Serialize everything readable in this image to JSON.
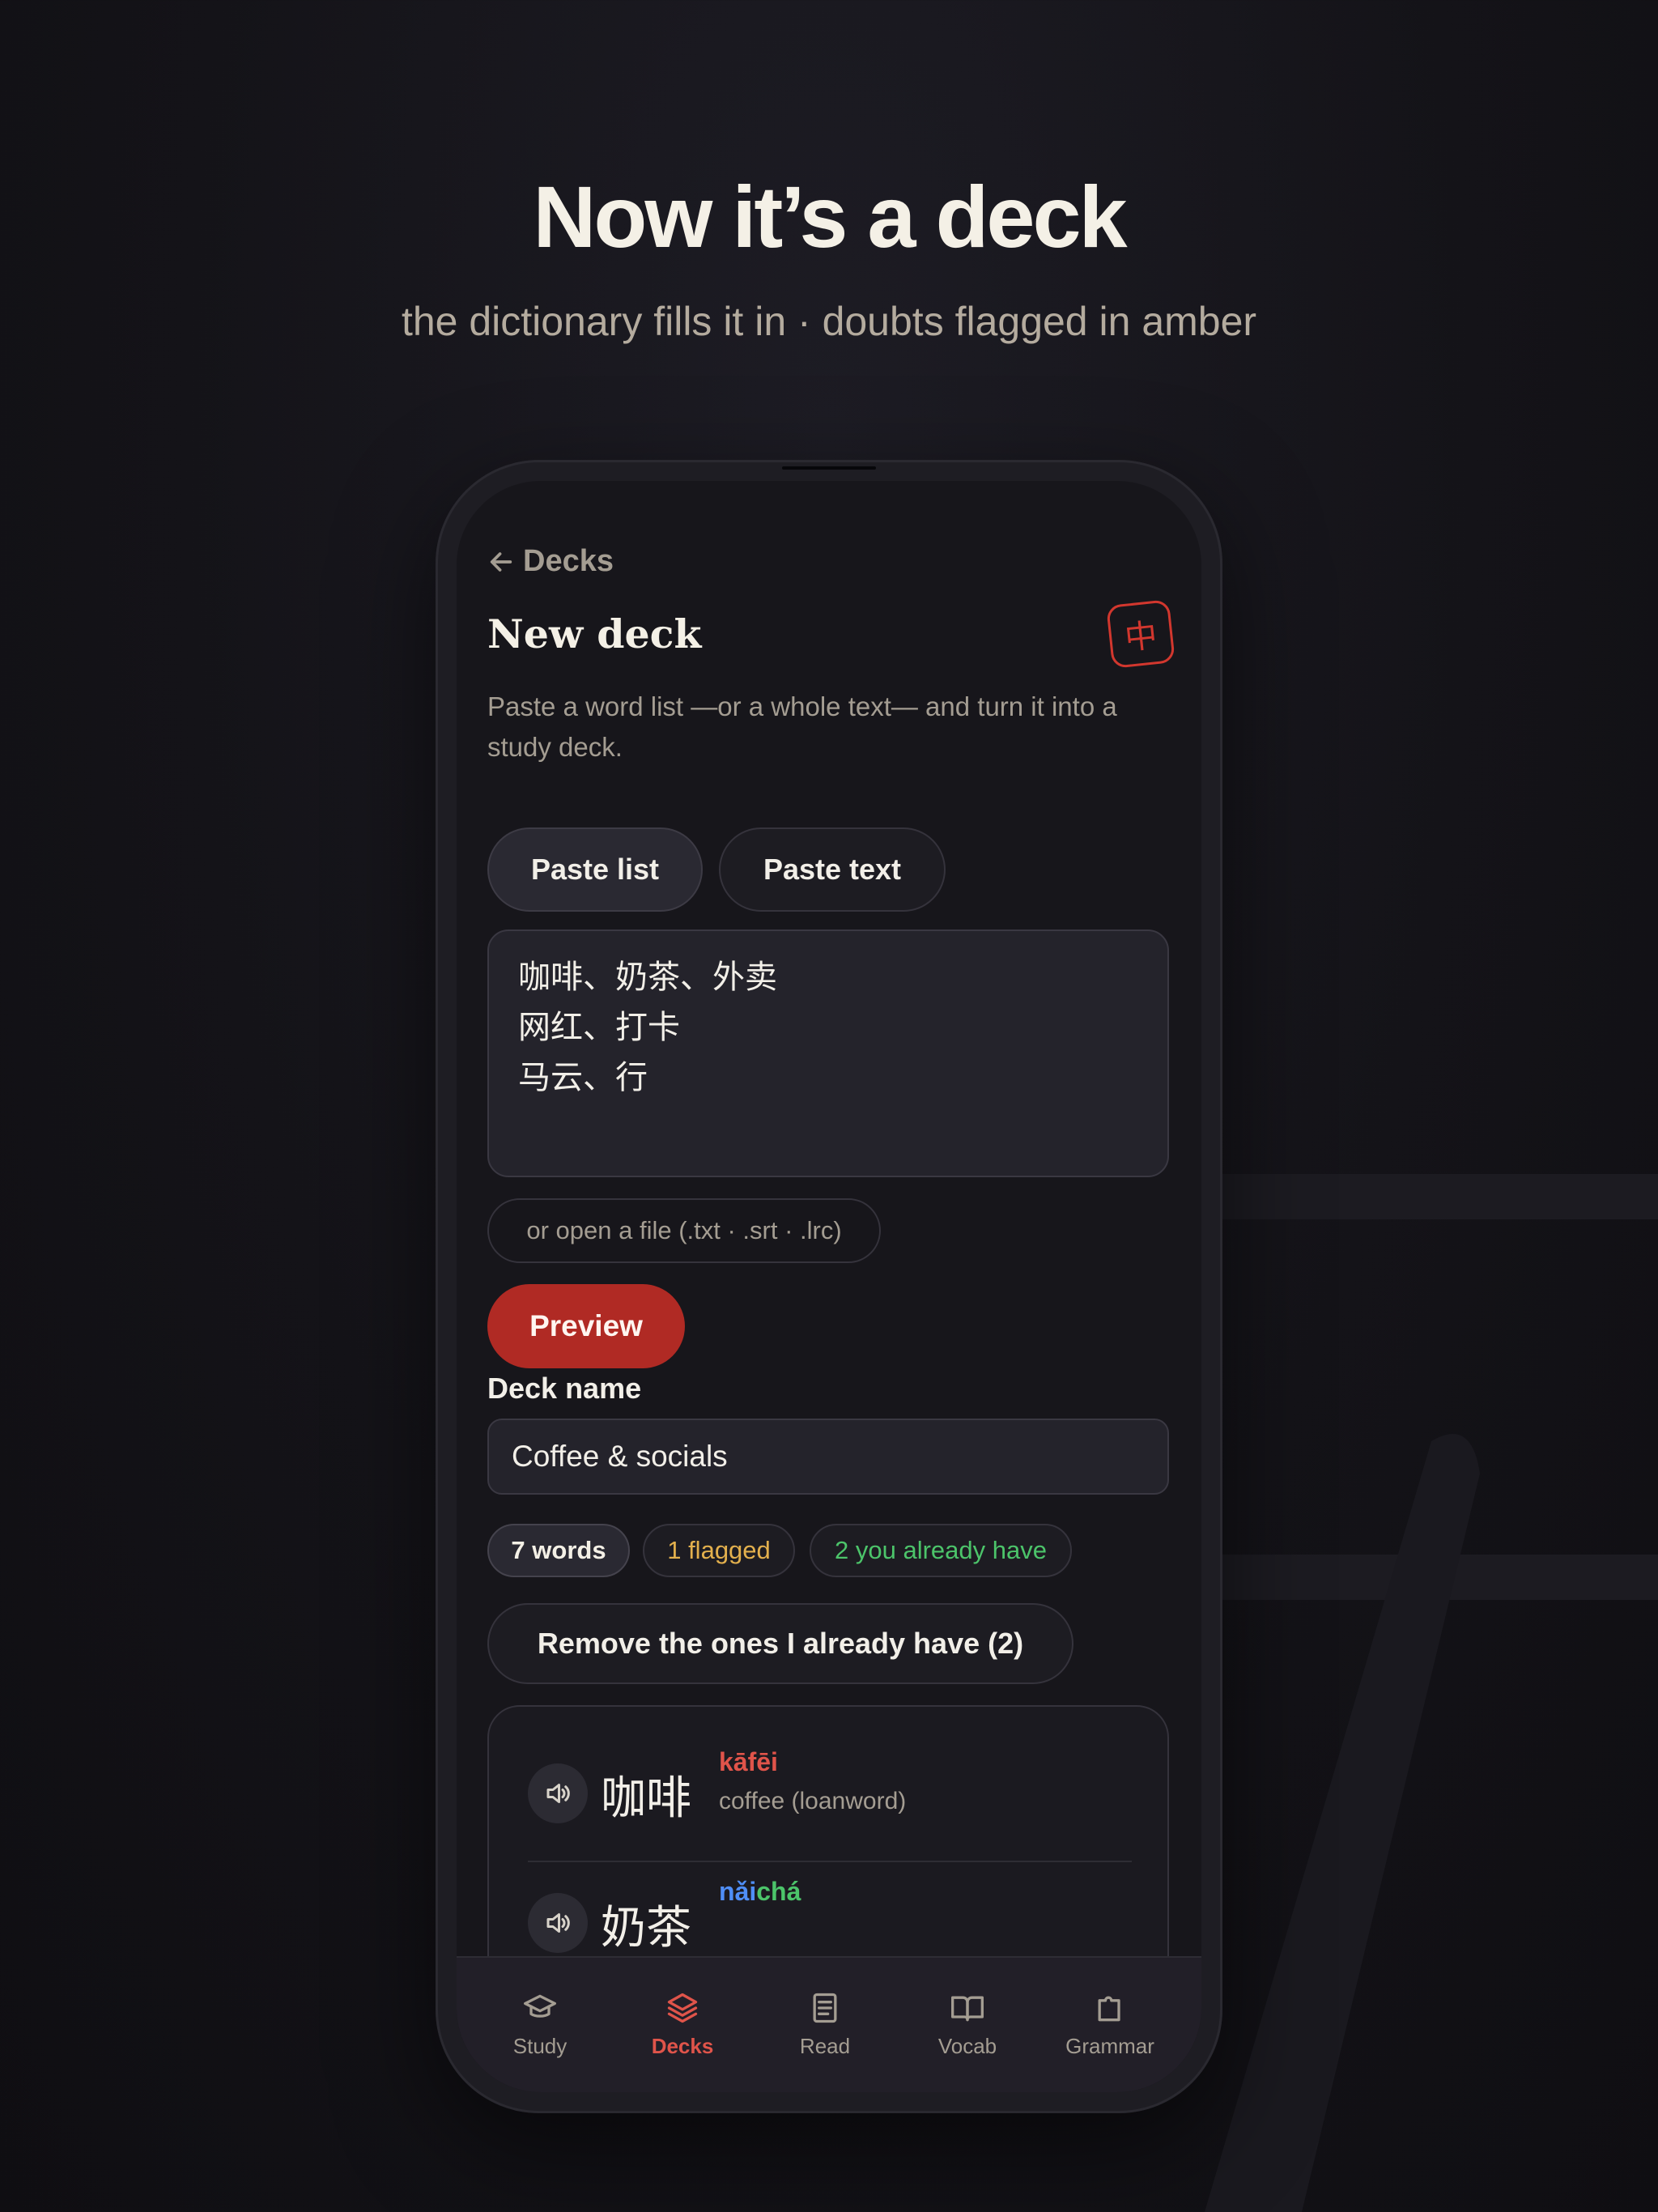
{
  "header": {
    "headline": "Now it’s a deck",
    "subhead": "the dictionary fills it in · doubts flagged in amber"
  },
  "screen": {
    "back_label": "Decks",
    "title": "New deck",
    "badge_char": "中",
    "intro": "Paste a word list —or a whole text— and turn it into a study deck.",
    "segments": [
      {
        "label": "Paste list",
        "selected": true
      },
      {
        "label": "Paste text",
        "selected": false
      }
    ],
    "textarea_value": "咖啡、奶茶、外卖\n网红、打卡\n马云、行",
    "file_chip": "or open a file (.txt · .srt · .lrc)",
    "preview_button": "Preview",
    "deck_name_label": "Deck name",
    "deck_name_value": "Coffee & socials",
    "stats": {
      "words": "7 words",
      "flagged": "1 flagged",
      "have": "2 you already have"
    },
    "remove_button": "Remove the ones I already have (2)",
    "words": [
      {
        "hanzi": "咖啡",
        "pinyin_parts": [
          "kāfēi"
        ],
        "gloss": "coffee (loanword)"
      },
      {
        "hanzi": "奶茶",
        "pinyin_parts": [
          "nǎi",
          "chá"
        ],
        "gloss": ""
      }
    ]
  },
  "tabs": [
    {
      "label": "Study",
      "icon": "graduation-cap-icon",
      "active": false
    },
    {
      "label": "Decks",
      "icon": "layers-icon",
      "active": true
    },
    {
      "label": "Read",
      "icon": "document-icon",
      "active": false
    },
    {
      "label": "Vocab",
      "icon": "open-book-icon",
      "active": false
    },
    {
      "label": "Grammar",
      "icon": "puzzle-icon",
      "active": false
    }
  ],
  "colors": {
    "accent_red": "#b02a24",
    "tone_red": "#e0544a",
    "amber": "#e3b04d",
    "green": "#4cc46a",
    "blue": "#4f8ef7"
  }
}
